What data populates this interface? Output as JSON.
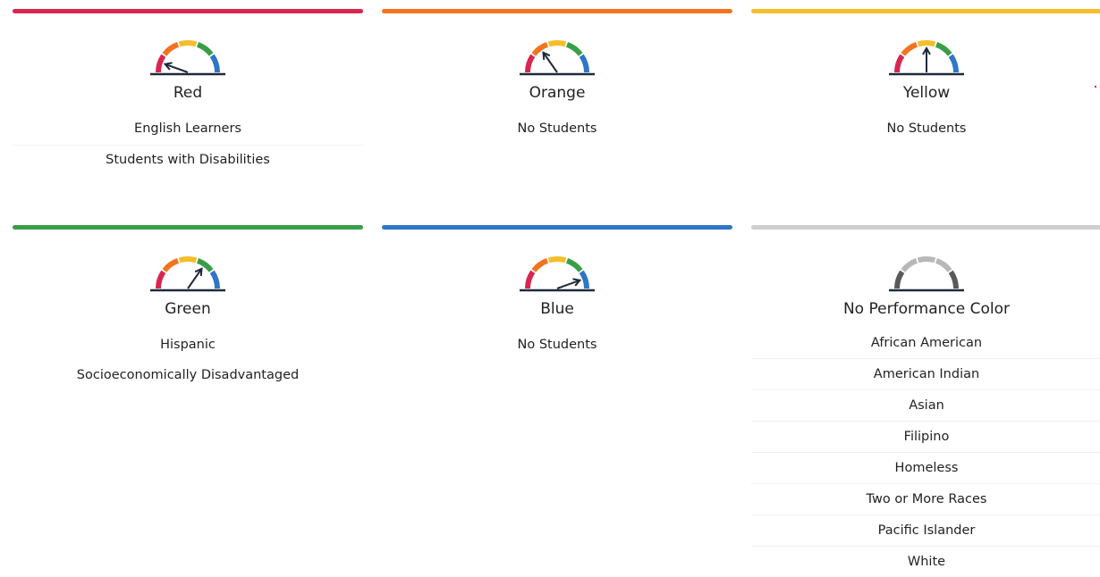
{
  "palette": {
    "red": "#d7264f",
    "orange": "#f4731f",
    "yellow": "#f6be2a",
    "green": "#3a9e48",
    "blue": "#2f76c6",
    "gray_bar": "#cfcfcf",
    "gray_light": "#b8b8b8",
    "gray_dark": "#5a5a5a",
    "needle": "#1f2a3a"
  },
  "cards": [
    {
      "id": "red",
      "title": "Red",
      "bar_color": "#d7264f",
      "needle_angle": 160,
      "student_groups": [
        "English Learners",
        "Students with Disabilities"
      ]
    },
    {
      "id": "orange",
      "title": "Orange",
      "bar_color": "#f4731f",
      "needle_angle": 125,
      "student_groups": [
        "No Students"
      ]
    },
    {
      "id": "yellow",
      "title": "Yellow",
      "bar_color": "#f6be2a",
      "needle_angle": 90,
      "student_groups": [
        "No Students"
      ]
    },
    {
      "id": "green",
      "title": "Green",
      "bar_color": "#3a9e48",
      "needle_angle": 55,
      "student_groups": [
        "Hispanic",
        "Socioeconomically Disadvantaged"
      ]
    },
    {
      "id": "blue",
      "title": "Blue",
      "bar_color": "#2f76c6",
      "needle_angle": 20,
      "student_groups": [
        "No Students"
      ]
    },
    {
      "id": "no-performance-color",
      "title": "No Performance Color",
      "bar_color": "#cfcfcf",
      "needle_angle": null,
      "student_groups": [
        "African American",
        "American Indian",
        "Asian",
        "Filipino",
        "Homeless",
        "Two or More Races",
        "Pacific Islander",
        "White"
      ]
    }
  ]
}
